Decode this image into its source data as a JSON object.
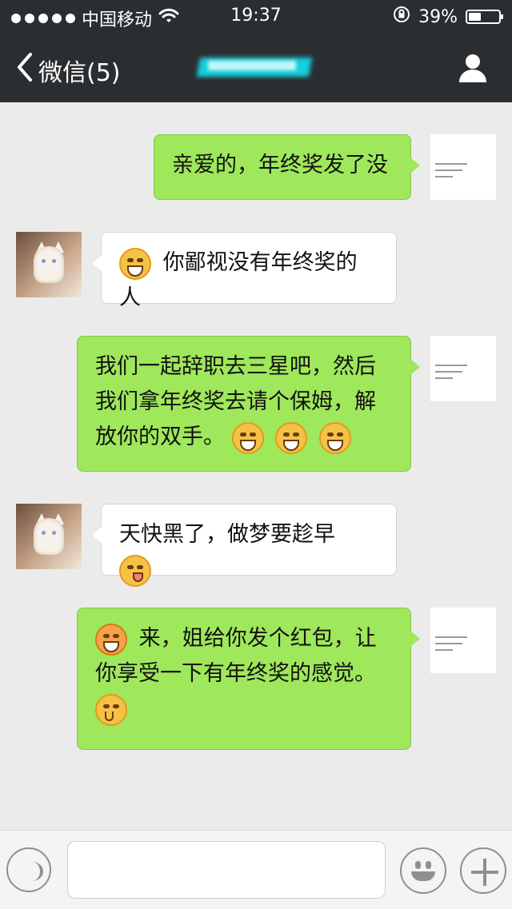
{
  "status": {
    "carrier": "中国移动",
    "time": "19:37",
    "battery": "39%",
    "signal_dots": 5
  },
  "nav": {
    "back_label": "微信(5)",
    "title": "",
    "profile_icon": "person-icon"
  },
  "messages": [
    {
      "side": "right",
      "text": "亲爱的，年终奖发了没",
      "emoji_before": [],
      "emoji_after": []
    },
    {
      "side": "left",
      "text": "你鄙视没有年终奖的人",
      "emoji_before": [
        "laughing-icon"
      ],
      "emoji_after": []
    },
    {
      "side": "right",
      "text": "我们一起辞职去三星吧，然后我们拿年终奖去请个保姆，解放你的双手。",
      "emoji_before": [],
      "emoji_after": [
        "grin-icon",
        "grin-icon",
        "grin-icon"
      ]
    },
    {
      "side": "left",
      "text": "天快黑了，做梦要趁早",
      "emoji_before": [],
      "emoji_after": [
        "wink-icon"
      ]
    },
    {
      "side": "right",
      "text": "来，姐给你发个红包，让你享受一下有年终奖的感觉。",
      "emoji_before": [
        "snail-icon"
      ],
      "emoji_after": [
        "thinking-icon"
      ]
    }
  ],
  "input": {
    "placeholder": ""
  },
  "icons": {
    "voice": "voice-icon",
    "emoji": "emoji-icon",
    "add": "add-icon"
  },
  "colors": {
    "bg": "#ebebeb",
    "nav": "#2b2e31",
    "bubble_green": "#9fe75b",
    "bubble_white": "#ffffff"
  }
}
